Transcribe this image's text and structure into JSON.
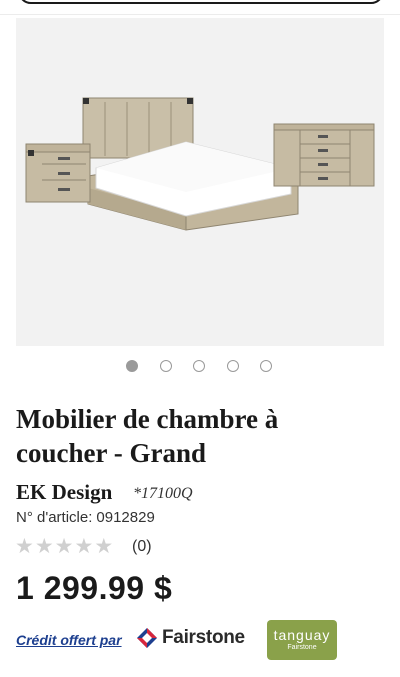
{
  "gallery": {
    "image": "bedroom-furniture-image",
    "slide_count": 5,
    "active_slide": 1
  },
  "product": {
    "title": "Mobilier de chambre à coucher - Grand",
    "brand": "EK Design",
    "model": "*17100Q",
    "article_label": "N° d'article:",
    "article_number": "0912829",
    "rating": 0,
    "rating_max": 5,
    "review_count": "(0)",
    "price": "1 299.99 $"
  },
  "financing": {
    "credit_text": "Crédit offert par",
    "partner_name": "Fairstone",
    "store_logo_text": "tanguay",
    "store_logo_sub": "Fairstone"
  },
  "colors": {
    "link_blue": "#1d3f8f",
    "star_empty": "#d0d0d0",
    "tanguay_green": "#8aa14a",
    "fairstone_red": "#d7263d",
    "fairstone_blue": "#1d3f8f"
  }
}
